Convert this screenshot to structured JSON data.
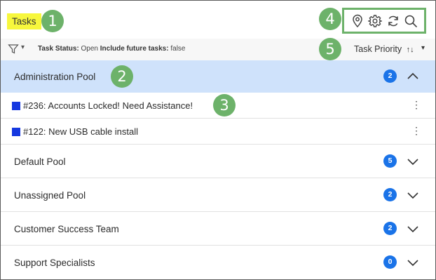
{
  "header": {
    "title": "Tasks",
    "icons": [
      "location-pin-icon",
      "gear-icon",
      "refresh-icon",
      "search-icon"
    ]
  },
  "callouts": [
    "1",
    "2",
    "3",
    "4",
    "5"
  ],
  "filter": {
    "status_label": "Task Status:",
    "status_value": "Open",
    "future_label": "Include future tasks:",
    "future_value": "false"
  },
  "sort": {
    "label": "Task Priority"
  },
  "pools": [
    {
      "name": "Administration Pool",
      "count": "2",
      "expanded": true,
      "tasks": [
        {
          "label": "#236:  Accounts Locked! Need Assistance!"
        },
        {
          "label": "#122:  New USB cable install"
        }
      ]
    },
    {
      "name": "Default Pool",
      "count": "5",
      "expanded": false
    },
    {
      "name": "Unassigned Pool",
      "count": "2",
      "expanded": false
    },
    {
      "name": "Customer Success Team",
      "count": "2",
      "expanded": false
    },
    {
      "name": "Support Specialists",
      "count": "0",
      "expanded": false
    }
  ],
  "colors": {
    "highlight": "#f7f73c",
    "callout": "#6db26a",
    "active_row": "#cfe2fb",
    "badge": "#1a73e8",
    "task_marker": "#1538e0"
  }
}
